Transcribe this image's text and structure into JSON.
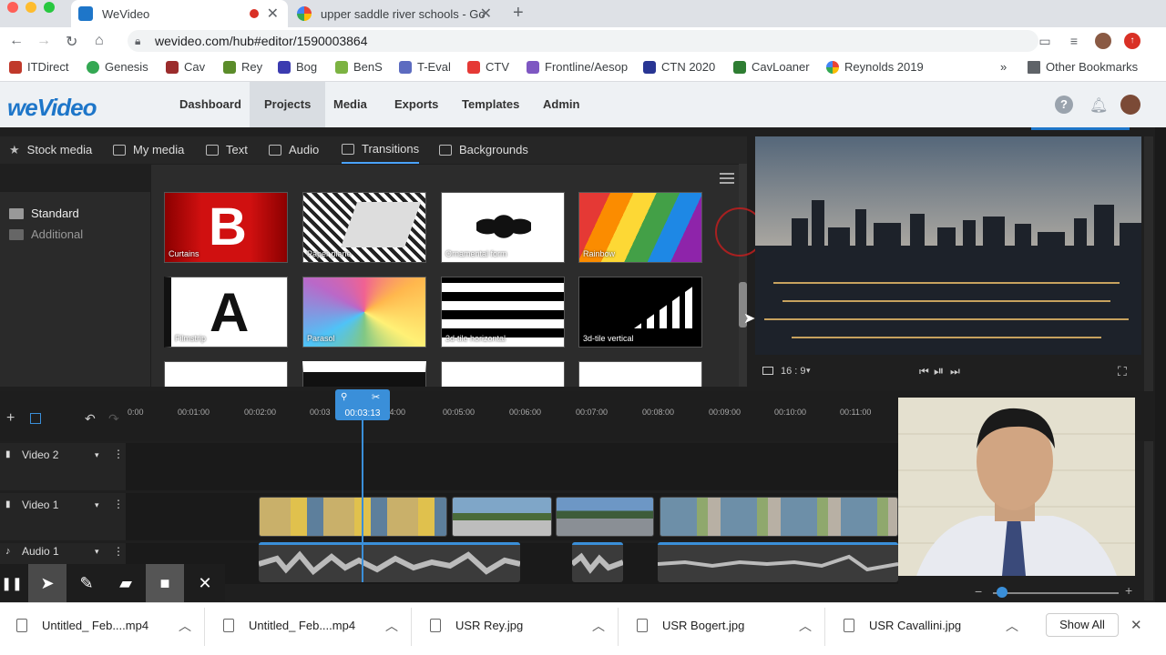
{
  "browser": {
    "tabs": [
      {
        "title": "WeVideo"
      },
      {
        "title": "upper saddle river schools - Go"
      }
    ],
    "url": "wevideo.com/hub#editor/1590003864",
    "bookmarks": [
      "ITDirect",
      "Genesis",
      "Cav",
      "Rey",
      "Bog",
      "BenS",
      "T-Eval",
      "CTV",
      "Frontline/Aesop",
      "CTN 2020",
      "CavLoaner",
      "Reynolds 2019"
    ],
    "other_bookmarks": "Other Bookmarks",
    "more": "»"
  },
  "app": {
    "logo": "weVideo",
    "nav": [
      "Dashboard",
      "Projects",
      "Media",
      "Exports",
      "Templates",
      "Admin"
    ],
    "media_tabs": [
      "Stock media",
      "My media",
      "Text",
      "Audio",
      "Transitions",
      "Backgrounds"
    ],
    "folders": [
      "Standard",
      "Additional"
    ],
    "transitions": [
      "Curtains",
      "Paper plane",
      "Ornamental form",
      "Rainbow",
      "Filmstrip",
      "Parasol",
      "3d-tile horizontal",
      "3d-tile vertical"
    ],
    "aspect": "16 : 9",
    "timeline": {
      "ticks": [
        "0:00",
        "00:01:00",
        "00:02:00",
        "00:03",
        "00:04:00",
        "00:05:00",
        "00:06:00",
        "00:07:00",
        "00:08:00",
        "00:09:00",
        "00:10:00",
        "00:11:00"
      ],
      "playhead_time": "00:03:13",
      "tracks": [
        "Video 2",
        "Video 1",
        "Audio 1"
      ]
    }
  },
  "downloads": {
    "files": [
      "Untitled_ Feb....mp4",
      "Untitled_ Feb....mp4",
      "USR Rey.jpg",
      "USR Bogert.jpg",
      "USR Cavallini.jpg"
    ],
    "show_all": "Show All"
  },
  "colors": {
    "accent": "#3a8fd9",
    "brand": "#1e76c9"
  }
}
